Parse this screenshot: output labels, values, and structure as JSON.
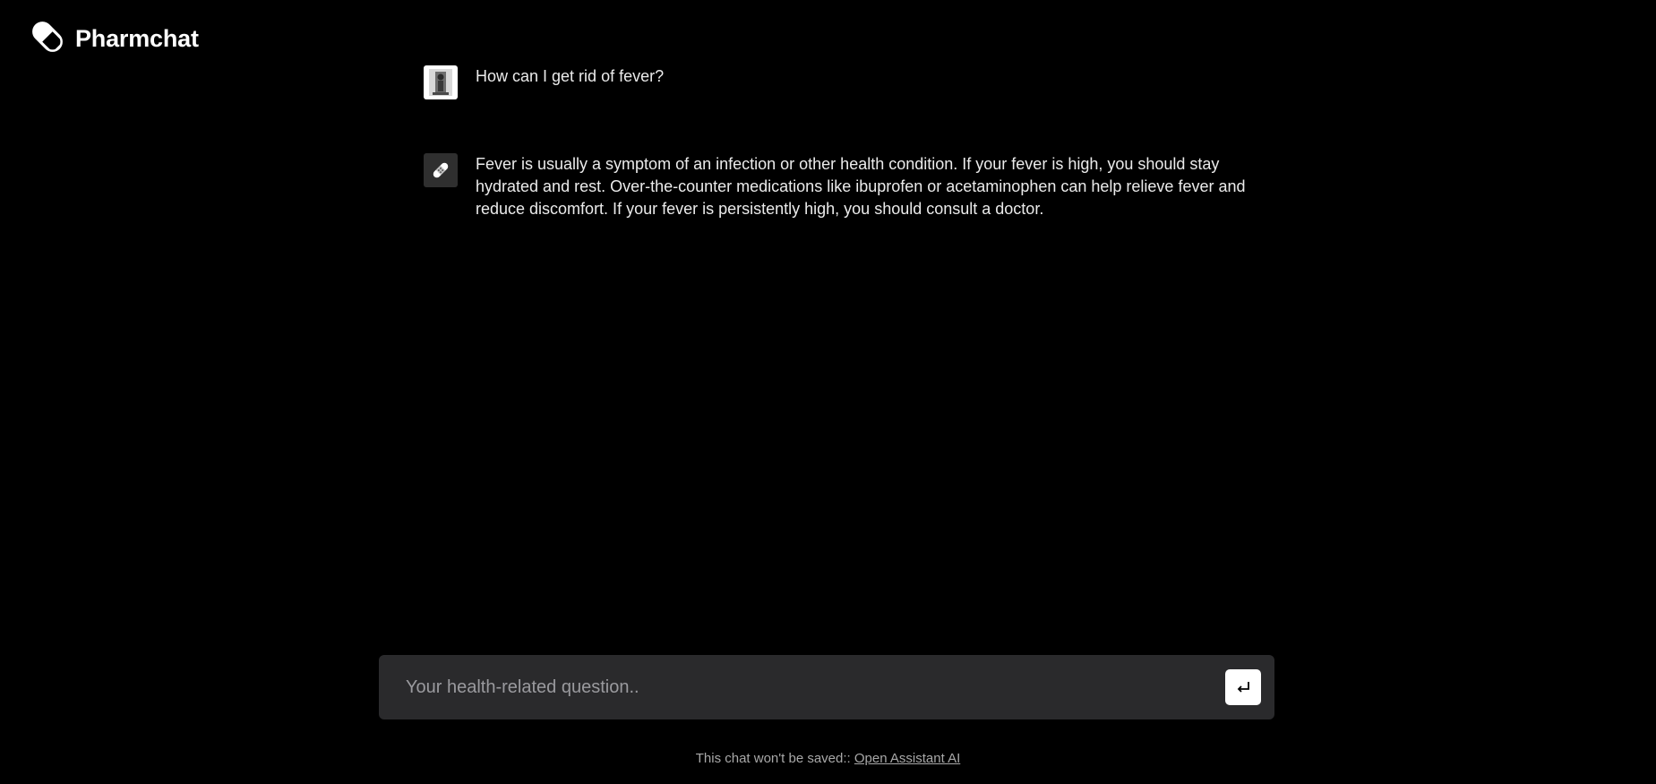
{
  "app": {
    "title": "Pharmchat",
    "logo_icon": "pill-icon"
  },
  "messages": [
    {
      "role": "user",
      "avatar_icon": "user-avatar-image",
      "text": "How can I get rid of fever?"
    },
    {
      "role": "assistant",
      "avatar_icon": "bandage-icon",
      "text": "Fever is usually a symptom of an infection or other health condition. If your fever is high, you should stay hydrated and rest. Over-the-counter medications like ibuprofen or acetaminophen can help relieve fever and reduce discomfort. If your fever is persistently high, you should consult a doctor."
    }
  ],
  "input": {
    "placeholder": "Your health-related question..",
    "value": "",
    "send_icon": "enter-icon"
  },
  "footer": {
    "text": "This chat won't be saved:: ",
    "link_label": "Open Assistant AI"
  },
  "colors": {
    "background": "#000000",
    "input_background": "#2a2a2c",
    "text": "#ebebeb",
    "footer_text": "#a8a8a8"
  }
}
